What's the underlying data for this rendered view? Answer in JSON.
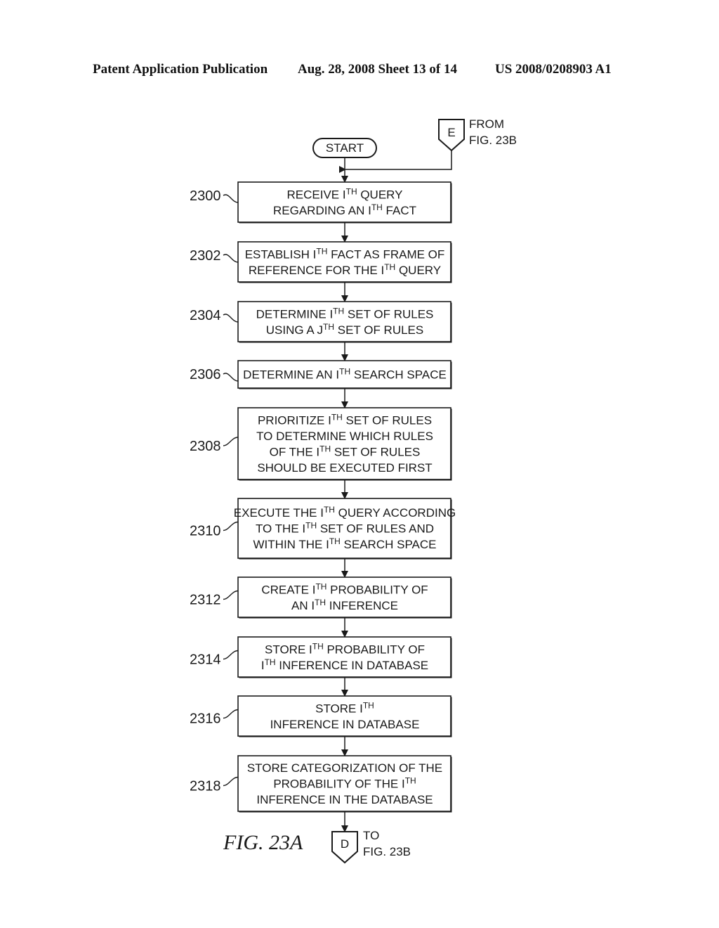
{
  "header": {
    "publication": "Patent Application Publication",
    "date_sheet": "Aug. 28, 2008  Sheet 13 of 14",
    "patent_number": "US 2008/0208903 A1"
  },
  "figure": {
    "label": "FIG. 23A",
    "start": "START",
    "connector_in": {
      "letter": "E",
      "line1": "FROM",
      "line2": "FIG. 23B"
    },
    "connector_out": {
      "letter": "D",
      "line1": "TO",
      "line2": "FIG. 23B"
    },
    "steps": [
      {
        "ref": "2300",
        "lines": [
          [
            [
              "RECEIVE I",
              ""
            ],
            [
              "TH",
              "sup"
            ],
            [
              " QUERY",
              ""
            ]
          ],
          [
            [
              "REGARDING AN I",
              ""
            ],
            [
              "TH",
              "sup"
            ],
            [
              " FACT",
              ""
            ]
          ]
        ]
      },
      {
        "ref": "2302",
        "lines": [
          [
            [
              "ESTABLISH I",
              ""
            ],
            [
              "TH",
              "sup"
            ],
            [
              " FACT AS FRAME OF",
              ""
            ]
          ],
          [
            [
              "REFERENCE FOR THE I",
              ""
            ],
            [
              "TH",
              "sup"
            ],
            [
              " QUERY",
              ""
            ]
          ]
        ]
      },
      {
        "ref": "2304",
        "lines": [
          [
            [
              "DETERMINE I",
              ""
            ],
            [
              "TH",
              "sup"
            ],
            [
              " SET OF RULES",
              ""
            ]
          ],
          [
            [
              "USING A J",
              ""
            ],
            [
              "TH",
              "sup"
            ],
            [
              " SET OF RULES",
              ""
            ]
          ]
        ]
      },
      {
        "ref": "2306",
        "lines": [
          [
            [
              "DETERMINE AN I",
              ""
            ],
            [
              "TH",
              "sup"
            ],
            [
              " SEARCH SPACE",
              ""
            ]
          ]
        ]
      },
      {
        "ref": "2308",
        "lines": [
          [
            [
              "PRIORITIZE I",
              ""
            ],
            [
              "TH",
              "sup"
            ],
            [
              " SET OF RULES",
              ""
            ]
          ],
          [
            [
              "TO DETERMINE WHICH RULES",
              ""
            ]
          ],
          [
            [
              "OF THE I",
              ""
            ],
            [
              "TH",
              "sup"
            ],
            [
              " SET OF RULES",
              ""
            ]
          ],
          [
            [
              "SHOULD BE EXECUTED FIRST",
              ""
            ]
          ]
        ]
      },
      {
        "ref": "2310",
        "lines": [
          [
            [
              "EXECUTE THE I",
              ""
            ],
            [
              "TH",
              "sup"
            ],
            [
              " QUERY ACCORDING",
              ""
            ]
          ],
          [
            [
              "TO THE I",
              ""
            ],
            [
              "TH",
              "sup"
            ],
            [
              " SET OF RULES AND",
              ""
            ]
          ],
          [
            [
              "WITHIN THE I",
              ""
            ],
            [
              "TH",
              "sup"
            ],
            [
              " SEARCH SPACE",
              ""
            ]
          ]
        ]
      },
      {
        "ref": "2312",
        "lines": [
          [
            [
              "CREATE I",
              ""
            ],
            [
              "TH",
              "sup"
            ],
            [
              " PROBABILITY OF",
              ""
            ]
          ],
          [
            [
              "AN I",
              ""
            ],
            [
              "TH",
              "sup"
            ],
            [
              " INFERENCE",
              ""
            ]
          ]
        ]
      },
      {
        "ref": "2314",
        "lines": [
          [
            [
              "STORE I",
              ""
            ],
            [
              "TH",
              "sup"
            ],
            [
              " PROBABILITY OF",
              ""
            ]
          ],
          [
            [
              "I",
              ""
            ],
            [
              "TH",
              "sup"
            ],
            [
              " INFERENCE IN DATABASE",
              ""
            ]
          ]
        ]
      },
      {
        "ref": "2316",
        "lines": [
          [
            [
              "STORE I",
              ""
            ],
            [
              "TH",
              "sup"
            ]
          ],
          [
            [
              "INFERENCE IN DATABASE",
              ""
            ]
          ]
        ]
      },
      {
        "ref": "2318",
        "lines": [
          [
            [
              "STORE CATEGORIZATION OF THE",
              ""
            ]
          ],
          [
            [
              "PROBABILITY OF THE I",
              ""
            ],
            [
              "TH",
              "sup"
            ]
          ],
          [
            [
              "INFERENCE IN THE DATABASE",
              ""
            ]
          ]
        ]
      }
    ]
  }
}
